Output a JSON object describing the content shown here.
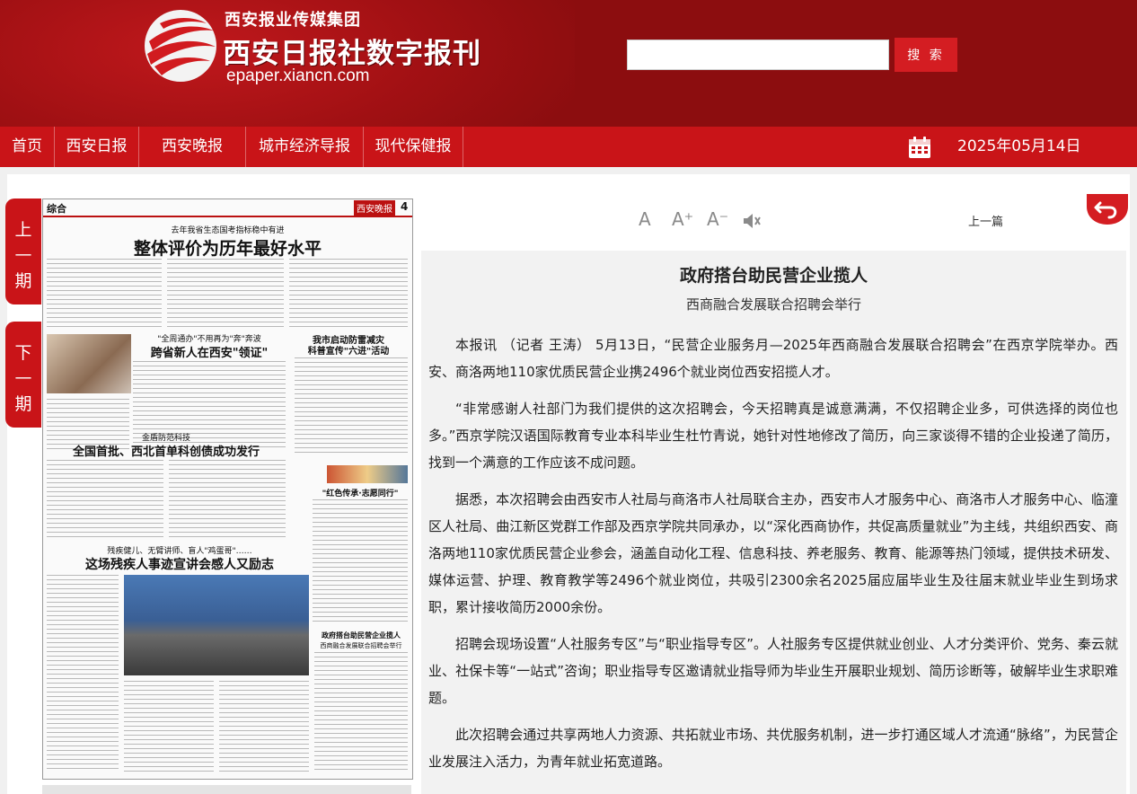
{
  "header": {
    "group_name": "西安报业传媒集团",
    "site_name": "西安日报社数字报刊",
    "site_url": "epaper.xiancn.com",
    "search_placeholder": "",
    "search_label": "搜 索"
  },
  "nav": {
    "items": [
      {
        "label": "首页"
      },
      {
        "label": "西安日报"
      },
      {
        "label": "西安晚报"
      },
      {
        "label": "城市经济导报"
      },
      {
        "label": "现代保健报"
      }
    ],
    "date": "2025年05月14日"
  },
  "pager": {
    "prev_chars": [
      "上",
      "—",
      "期"
    ],
    "next_chars": [
      "下",
      "—",
      "期"
    ]
  },
  "newspaper": {
    "section": "综合",
    "masthead": "西安晚报",
    "page_no": "4",
    "lead_kicker": "去年我省生态国考指标稳中有进",
    "lead_title": "整体评价为历年最好水平",
    "kicker2": "\"全周通办\"不用再为\"奔\"奔波",
    "title2": "跨省新人在西安\"领证\"",
    "kicker3": "我市启动防雷减灾",
    "title3": "科普宣传\"六进\"活动",
    "kicker4": "金盾防范科技",
    "title4": "全国首批、西北首单科创债成功发行",
    "title5": "\"红色传承·志愿同行\"",
    "kicker6": "残疾健儿、无臂讲师、盲人\"鸡蛋哥\"……",
    "title6": "这场残疾人事迹宣讲会感人又励志",
    "title7": "政府搭台助民营企业揽人",
    "subtitle7": "西商融合发展联合招聘会举行"
  },
  "toolbar": {
    "font_normal": "A",
    "font_plus": "A⁺",
    "font_minus": "A⁻",
    "prev_label": "上一篇"
  },
  "article": {
    "title": "政府搭台助民营企业揽人",
    "subtitle": "西商融合发展联合招聘会举行",
    "paragraphs": [
      "本报讯 （记者 王涛） 5月13日，“民营企业服务月—2025年西商融合发展联合招聘会”在西京学院举办。西安、商洛两地110家优质民营企业携2496个就业岗位西安招揽人才。",
      "“非常感谢人社部门为我们提供的这次招聘会，今天招聘真是诚意满满，不仅招聘企业多，可供选择的岗位也多。”西京学院汉语国际教育专业本科毕业生杜竹青说，她针对性地修改了简历，向三家谈得不错的企业投递了简历，找到一个满意的工作应该不成问题。",
      "据悉，本次招聘会由西安市人社局与商洛市人社局联合主办，西安市人才服务中心、商洛市人才服务中心、临潼区人社局、曲江新区党群工作部及西京学院共同承办，以“深化西商协作，共促高质量就业”为主线，共组织西安、商洛两地110家优质民营企业参会，涵盖自动化工程、信息科技、养老服务、教育、能源等热门领域，提供技术研发、媒体运营、护理、教育教学等2496个就业岗位，共吸引2300余名2025届应届毕业生及往届末就业毕业生到场求职，累计接收简历2000余份。",
      "招聘会现场设置“人社服务专区”与“职业指导专区”。人社服务专区提供就业创业、人才分类评价、党务、秦云就业、社保卡等“一站式”咨询；职业指导专区邀请就业指导师为毕业生开展职业规划、简历诊断等，破解毕业生求职难题。",
      "此次招聘会通过共享两地人力资源、共拓就业市场、共优服务机制，进一步打通区域人才流通“脉络”，为民营企业发展注入活力，为青年就业拓宽道路。"
    ]
  },
  "colors": {
    "header_bg": "#8c0d0f",
    "nav_bg": "#c91418",
    "accent": "#d41d22"
  }
}
